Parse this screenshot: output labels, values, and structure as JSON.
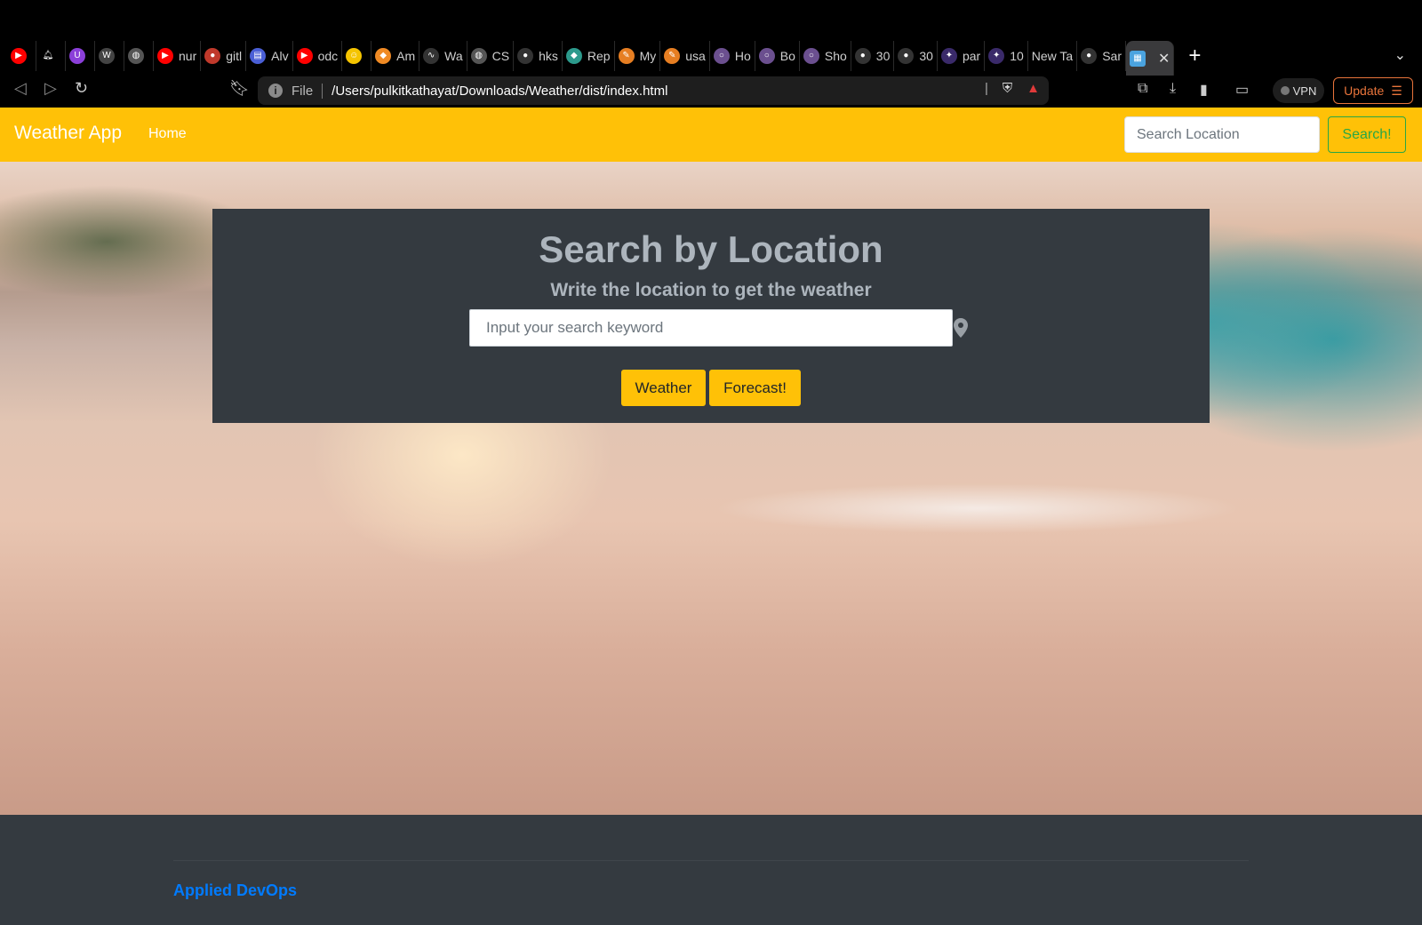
{
  "browser": {
    "tabs": [
      {
        "label": "",
        "color": "#ff0000",
        "icon": "youtube-icon"
      },
      {
        "label": "",
        "color": "#000000",
        "icon": "bell-icon"
      },
      {
        "label": "",
        "color": "#8b3fd9",
        "icon": "u-icon"
      },
      {
        "label": "",
        "color": "#444444",
        "icon": "wordpress-icon"
      },
      {
        "label": "",
        "color": "#555555",
        "icon": "globe-icon"
      },
      {
        "label": "nur",
        "color": "#ff0000",
        "icon": "youtube-icon"
      },
      {
        "label": "gitl",
        "color": "#c0392b",
        "icon": "circle-icon"
      },
      {
        "label": "Alv",
        "color": "#4a5fd6",
        "icon": "form-icon"
      },
      {
        "label": "odc",
        "color": "#ff0000",
        "icon": "youtube-icon"
      },
      {
        "label": "",
        "color": "#f5c400",
        "icon": "emoji-icon"
      },
      {
        "label": "Am",
        "color": "#f08a24",
        "icon": "box-icon"
      },
      {
        "label": "Wa",
        "color": "#333333",
        "icon": "wave-icon"
      },
      {
        "label": "CS",
        "color": "#555555",
        "icon": "globe-icon"
      },
      {
        "label": "hks",
        "color": "#333333",
        "icon": "github-icon"
      },
      {
        "label": "Rep",
        "color": "#2c9a8c",
        "icon": "diamond-icon"
      },
      {
        "label": "My",
        "color": "#e67e22",
        "icon": "pen-icon"
      },
      {
        "label": "usa",
        "color": "#e67e22",
        "icon": "pen-icon"
      },
      {
        "label": "Ho",
        "color": "#6b4f8f",
        "icon": "ring-icon"
      },
      {
        "label": "Bo",
        "color": "#6b4f8f",
        "icon": "ring-icon"
      },
      {
        "label": "Sho",
        "color": "#6b4f8f",
        "icon": "ring-icon"
      },
      {
        "label": "30",
        "color": "#333333",
        "icon": "github-icon"
      },
      {
        "label": "30",
        "color": "#333333",
        "icon": "github-icon"
      },
      {
        "label": "par",
        "color": "#3a2a6a",
        "icon": "star-icon"
      },
      {
        "label": "10",
        "color": "#3a2a6a",
        "icon": "star-icon"
      },
      {
        "label": "New Ta",
        "color": "#000000",
        "icon": "blank-icon"
      },
      {
        "label": "Sar",
        "color": "#333333",
        "icon": "github-icon"
      }
    ],
    "active_tab_icon": "image-icon",
    "address": {
      "scheme": "File",
      "url": "/Users/pulkitkathayat/Downloads/Weather/dist/index.html"
    },
    "vpn_label": "VPN",
    "update_label": "Update"
  },
  "navbar": {
    "brand": "Weather App",
    "home": "Home",
    "search_placeholder": "Search Location",
    "search_button": "Search!"
  },
  "hero": {
    "title": "Search by Location",
    "subtitle": "Write the location to get the weather",
    "input_placeholder": "Input your search keyword",
    "weather_button": "Weather",
    "forecast_button": "Forecast!"
  },
  "footer": {
    "link": "Applied DevOps"
  },
  "colors": {
    "navbar": "#ffc107",
    "panel": "#343a40",
    "accent_green": "#28a745",
    "link_blue": "#007bff"
  }
}
